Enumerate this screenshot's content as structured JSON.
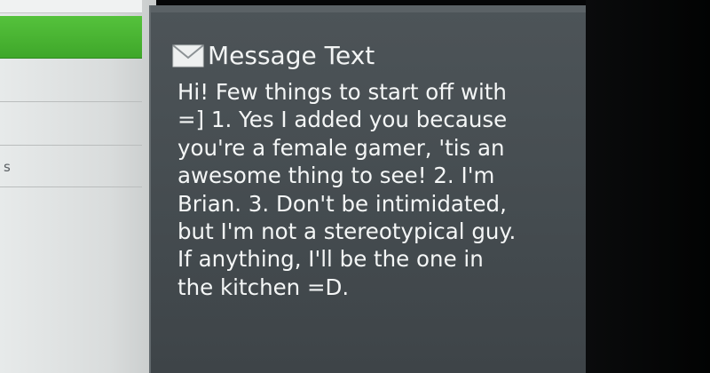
{
  "sidebar": {
    "items": [
      {
        "label": "",
        "selected": true
      },
      {
        "label": "",
        "selected": false
      },
      {
        "label": "",
        "selected": false
      },
      {
        "label": "s",
        "selected": false
      },
      {
        "label": "",
        "selected": false
      }
    ]
  },
  "message": {
    "icon": "envelope-icon",
    "title": "Message Text",
    "lines": [
      "Hi! Few things to start off with",
      "=] 1. Yes I added you because",
      "you're a female gamer, 'tis an",
      "awesome thing to see! 2. I'm",
      "Brian. 3. Don't be intimidated,",
      "but I'm not a stereotypical guy.",
      "If anything, I'll be the one in",
      "the kitchen =D."
    ]
  },
  "colors": {
    "accent_green": "#4cb834",
    "panel_background": "#474e52",
    "menu_background": "#dfe2e2",
    "text": "#f4f6f6"
  }
}
